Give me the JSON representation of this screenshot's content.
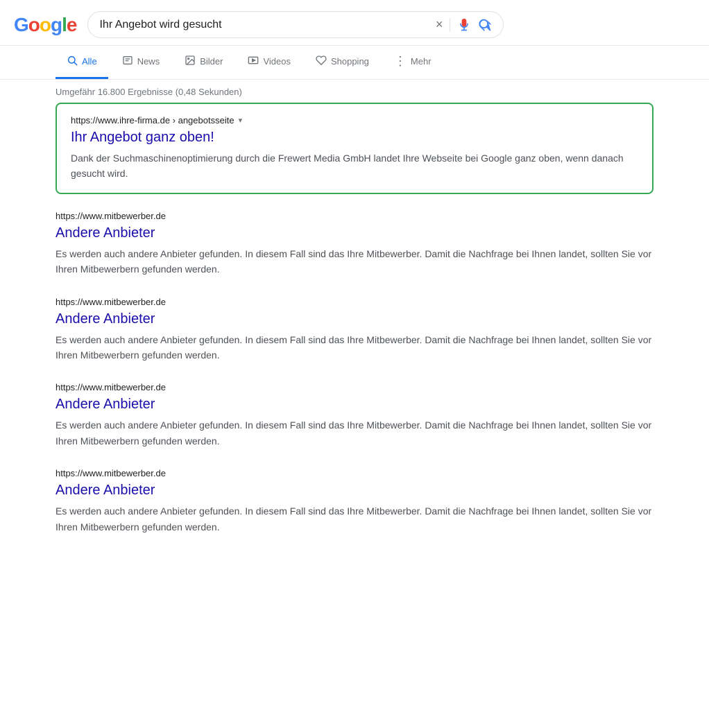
{
  "header": {
    "logo": {
      "letters": [
        "G",
        "o",
        "o",
        "g",
        "l",
        "e"
      ],
      "colors": [
        "#4285F4",
        "#EA4335",
        "#FBBC05",
        "#4285F4",
        "#34A853",
        "#EA4335"
      ]
    },
    "search_query": "Ihr Angebot wird gesucht",
    "clear_label": "×"
  },
  "nav": {
    "tabs": [
      {
        "id": "alle",
        "label": "Alle",
        "icon": "🔍",
        "active": true
      },
      {
        "id": "news",
        "label": "News",
        "icon": "📄",
        "active": false
      },
      {
        "id": "bilder",
        "label": "Bilder",
        "icon": "🖼",
        "active": false
      },
      {
        "id": "videos",
        "label": "Videos",
        "icon": "▶",
        "active": false
      },
      {
        "id": "shopping",
        "label": "Shopping",
        "icon": "🏷",
        "active": false
      },
      {
        "id": "mehr",
        "label": "Mehr",
        "icon": "⋮",
        "active": false
      }
    ]
  },
  "results_info": "Umgefähr 16.800 Ergebnisse (0,48 Sekunden)",
  "featured_result": {
    "url": "https://www.ihre-firma.de › angebotsseite",
    "title": "Ihr Angebot ganz oben!",
    "snippet": "Dank der Suchmaschinenoptimierung durch die Frewert Media GmbH landet Ihre Webseite bei Google ganz oben, wenn danach gesucht wird."
  },
  "results": [
    {
      "url": "https://www.mitbewerber.de",
      "title": "Andere Anbieter",
      "snippet": "Es werden auch andere Anbieter gefunden. In diesem Fall sind das Ihre Mitbewerber. Damit die Nachfrage bei Ihnen landet, sollten Sie vor Ihren Mitbewerbern gefunden werden."
    },
    {
      "url": "https://www.mitbewerber.de",
      "title": "Andere Anbieter",
      "snippet": "Es werden auch andere Anbieter gefunden. In diesem Fall sind das Ihre Mitbewerber. Damit die Nachfrage bei Ihnen landet, sollten Sie vor Ihren Mitbewerbern gefunden werden."
    },
    {
      "url": "https://www.mitbewerber.de",
      "title": "Andere Anbieter",
      "snippet": "Es werden auch andere Anbieter gefunden. In diesem Fall sind das Ihre Mitbewerber. Damit die Nachfrage bei Ihnen landet, sollten Sie vor Ihren Mitbewerbern gefunden werden."
    },
    {
      "url": "https://www.mitbewerber.de",
      "title": "Andere Anbieter",
      "snippet": "Es werden auch andere Anbieter gefunden. In diesem Fall sind das Ihre Mitbewerber. Damit die Nachfrage bei Ihnen landet, sollten Sie vor Ihren Mitbewerbern gefunden werden."
    }
  ]
}
